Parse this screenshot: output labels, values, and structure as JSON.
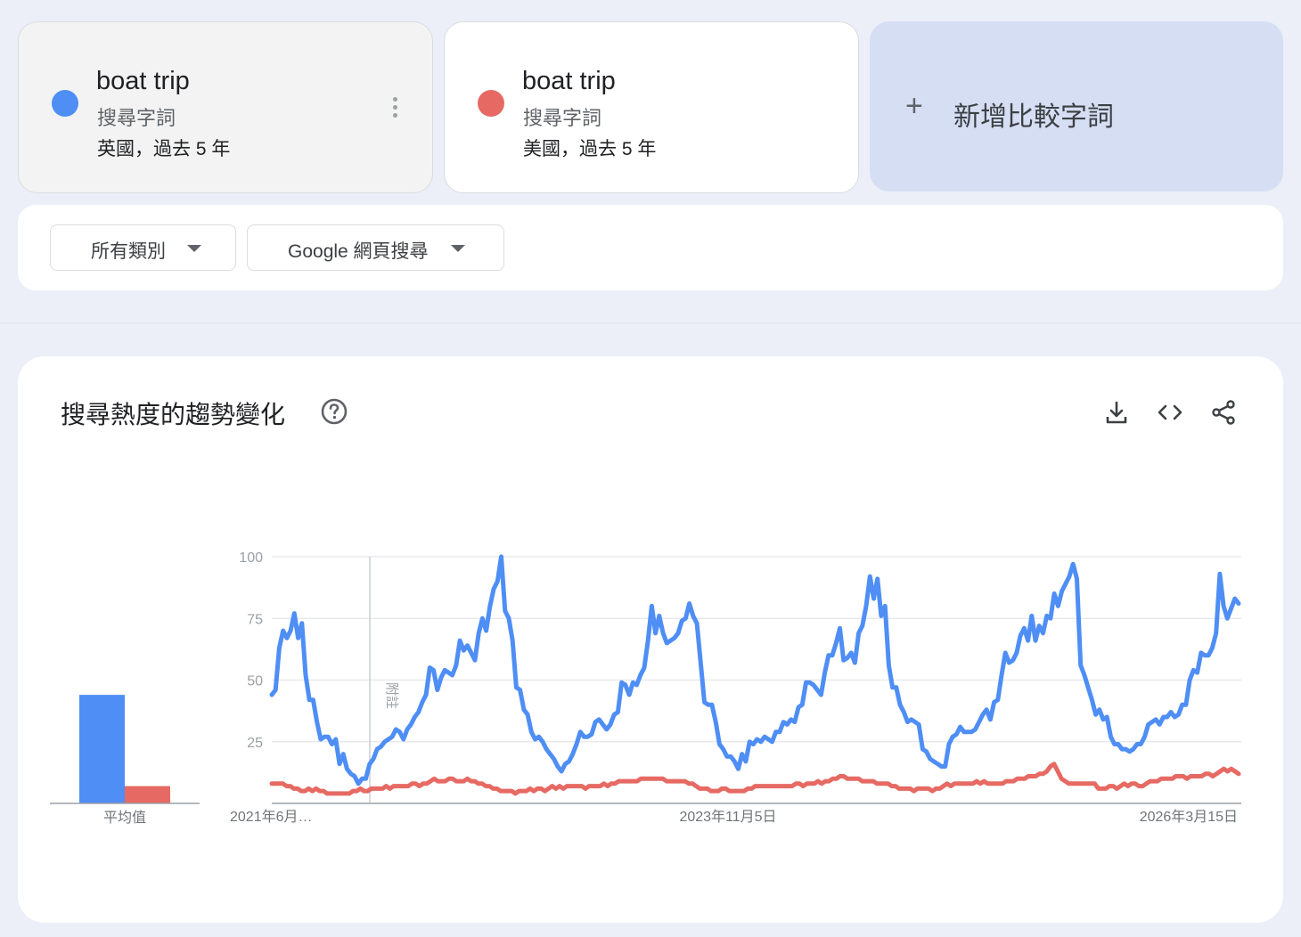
{
  "terms": [
    {
      "title": "boat trip",
      "type": "搜尋字詞",
      "region": "英國，過去 5 年",
      "color": "#4e8ef5"
    },
    {
      "title": "boat trip",
      "type": "搜尋字詞",
      "region": "美國，過去 5 年",
      "color": "#e66a63"
    }
  ],
  "add_term": {
    "label": "新增比較字詞",
    "plus": "+"
  },
  "filters": {
    "category": "所有類別",
    "search_type": "Google 網頁搜尋"
  },
  "chart_section": {
    "title": "搜尋熱度的趨勢變化",
    "help_icon": "help-circle-icon",
    "tools": [
      "download-icon",
      "embed-code-icon",
      "share-icon"
    ]
  },
  "chart_data": [
    {
      "type": "bar",
      "categories": [
        "boat trip (英國)",
        "boat trip (美國)"
      ],
      "values": [
        44,
        7
      ],
      "xlabel": "平均值",
      "ylim": [
        0,
        100
      ]
    },
    {
      "type": "line",
      "x_tick_labels": [
        "2021年6月…",
        "2023年11月5日",
        "2026年3月15日"
      ],
      "yticks": [
        25,
        50,
        75,
        100
      ],
      "ylim": [
        0,
        100
      ],
      "annotation": "附註",
      "grid": true,
      "series": [
        {
          "color": "#4e8ef5",
          "values": [
            44,
            46,
            63,
            70,
            67,
            70,
            77,
            67,
            73,
            52,
            42,
            42,
            33,
            26,
            27,
            27,
            24,
            26,
            16,
            20,
            14,
            12,
            11,
            8,
            10,
            10,
            16,
            18,
            22,
            23,
            25,
            26,
            27,
            30,
            29,
            26,
            30,
            32,
            35,
            37,
            41,
            44,
            55,
            54,
            46,
            51,
            54,
            53,
            52,
            56,
            66,
            62,
            64,
            61,
            58,
            69,
            75,
            70,
            80,
            87,
            90,
            100,
            78,
            75,
            66,
            47,
            46,
            38,
            36,
            29,
            26,
            27,
            25,
            22,
            20,
            18,
            15,
            13,
            16,
            17,
            20,
            24,
            29,
            27,
            27,
            28,
            33,
            34,
            32,
            30,
            32,
            36,
            37,
            49,
            48,
            44,
            49,
            48,
            52,
            55,
            66,
            80,
            69,
            76,
            69,
            65,
            66,
            67,
            69,
            74,
            75,
            81,
            76,
            73,
            57,
            41,
            40,
            40,
            33,
            24,
            22,
            19,
            19,
            17,
            14,
            20,
            17,
            25,
            24,
            26,
            25,
            27,
            26,
            25,
            29,
            29,
            33,
            32,
            34,
            33,
            39,
            40,
            49,
            49,
            48,
            46,
            44,
            53,
            60,
            60,
            65,
            71,
            58,
            59,
            61,
            57,
            69,
            72,
            80,
            92,
            83,
            91,
            76,
            80,
            56,
            47,
            47,
            40,
            37,
            33,
            34,
            33,
            32,
            22,
            21,
            18,
            17,
            16,
            15,
            15,
            24,
            27,
            28,
            31,
            29,
            29,
            29,
            30,
            33,
            36,
            38,
            34,
            41,
            42,
            52,
            61,
            57,
            58,
            61,
            68,
            71,
            66,
            76,
            66,
            72,
            69,
            76,
            75,
            85,
            80,
            86,
            89,
            92,
            97,
            91,
            56,
            52,
            47,
            42,
            36,
            38,
            34,
            35,
            27,
            24,
            24,
            22,
            22,
            21,
            22,
            24,
            24,
            27,
            32,
            33,
            34,
            32,
            35,
            35,
            37,
            35,
            36,
            40,
            40,
            50,
            54,
            53,
            61,
            60,
            60,
            63,
            69,
            93,
            80,
            75,
            79,
            83,
            81
          ]
        },
        {
          "color": "#e66a63",
          "values": [
            8,
            8,
            8,
            8,
            7,
            7,
            6,
            6,
            5,
            5,
            6,
            5,
            6,
            5,
            5,
            4,
            4,
            4,
            4,
            4,
            4,
            4,
            5,
            5,
            6,
            5,
            5,
            6,
            6,
            6,
            6,
            7,
            6,
            7,
            7,
            7,
            7,
            7,
            8,
            8,
            7,
            8,
            8,
            9,
            10,
            9,
            9,
            9,
            10,
            10,
            9,
            9,
            9,
            10,
            9,
            9,
            8,
            8,
            7,
            7,
            6,
            6,
            5,
            5,
            5,
            5,
            4,
            5,
            5,
            5,
            6,
            5,
            6,
            6,
            5,
            6,
            7,
            6,
            7,
            6,
            7,
            7,
            7,
            7,
            7,
            6,
            7,
            7,
            7,
            7,
            8,
            7,
            8,
            8,
            9,
            9,
            9,
            9,
            9,
            9,
            10,
            10,
            10,
            10,
            10,
            10,
            10,
            9,
            9,
            9,
            9,
            9,
            9,
            8,
            8,
            7,
            6,
            6,
            6,
            5,
            5,
            5,
            6,
            6,
            5,
            5,
            5,
            5,
            5,
            6,
            6,
            7,
            7,
            7,
            7,
            7,
            7,
            7,
            7,
            7,
            7,
            7,
            8,
            8,
            7,
            8,
            8,
            8,
            9,
            8,
            9,
            9,
            10,
            10,
            11,
            11,
            10,
            10,
            10,
            10,
            9,
            9,
            9,
            9,
            8,
            8,
            8,
            8,
            7,
            7,
            6,
            6,
            6,
            6,
            5,
            6,
            6,
            6,
            6,
            5,
            6,
            6,
            7,
            8,
            7,
            8,
            8,
            8,
            8,
            8,
            8,
            9,
            8,
            9,
            8,
            8,
            8,
            8,
            8,
            9,
            9,
            9,
            10,
            10,
            10,
            11,
            11,
            11,
            12,
            12,
            13,
            15,
            16,
            13,
            10,
            9,
            8,
            8,
            8,
            8,
            8,
            8,
            8,
            8,
            6,
            6,
            6,
            7,
            7,
            6,
            7,
            8,
            7,
            8,
            8,
            7,
            7,
            8,
            9,
            9,
            9,
            10,
            10,
            10,
            10,
            11,
            11,
            11,
            10,
            11,
            11,
            11,
            11,
            12,
            12,
            11,
            12,
            13,
            14,
            13,
            14,
            13,
            12
          ]
        }
      ]
    }
  ]
}
